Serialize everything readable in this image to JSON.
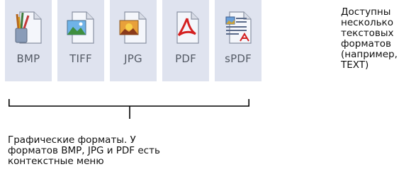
{
  "formats": [
    {
      "label": "BMP",
      "icon": "paint-brushes-document-icon"
    },
    {
      "label": "TIFF",
      "icon": "landscape-image-document-icon"
    },
    {
      "label": "JPG",
      "icon": "sunset-image-document-icon"
    },
    {
      "label": "PDF",
      "icon": "acrobat-pdf-document-icon"
    },
    {
      "label": "sPDF",
      "icon": "searchable-pdf-text-document-icon"
    }
  ],
  "right_note_lines": [
    "Доступны",
    "несколько",
    "текстовых",
    "форматов",
    "(например,",
    "TEXT)"
  ],
  "bottom_note_lines": [
    "Графические форматы. У",
    "форматов BMP, JPG и PDF есть",
    "контекстные меню"
  ],
  "colors": {
    "tile_bg": "#dfe3ef",
    "label_text": "#555b66",
    "bracket_line": "#000000"
  }
}
